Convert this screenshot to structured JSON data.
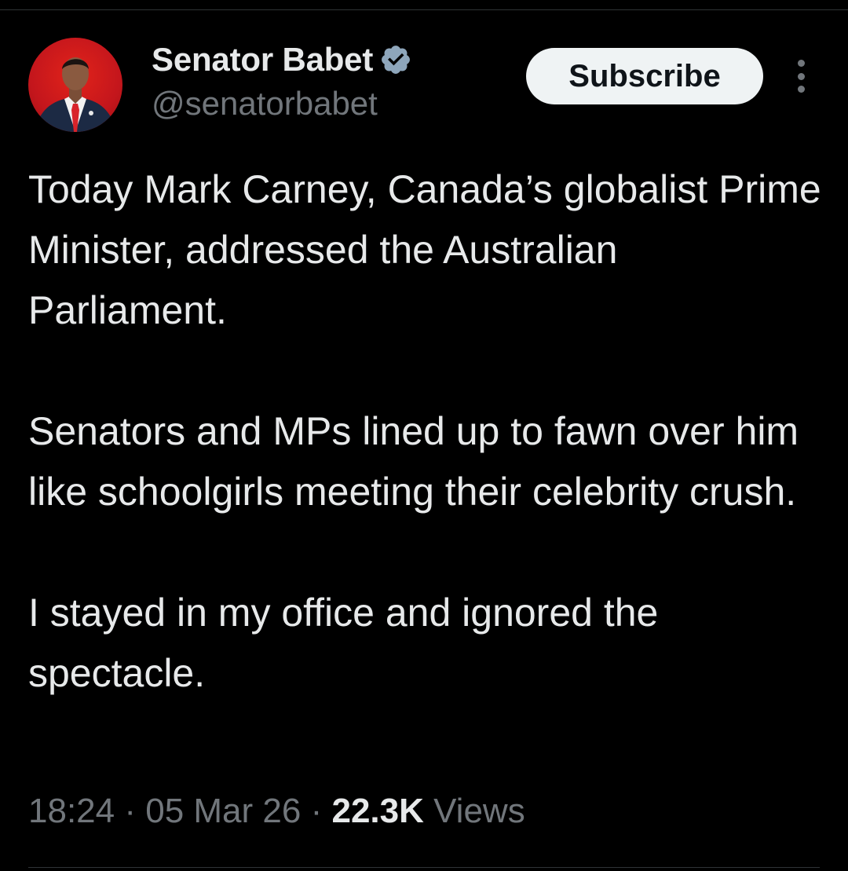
{
  "author": {
    "display_name": "Senator Babet",
    "handle": "@senatorbabet",
    "verified_icon": "verified-badge-icon",
    "avatar_icon": "profile-photo"
  },
  "header": {
    "subscribe_label": "Subscribe",
    "more_icon": "more-options-icon"
  },
  "tweet": {
    "paragraphs": [
      "Today Mark Carney, Canada’s globalist Prime Minister, addressed the Australian Parliament.",
      "Senators and MPs lined up to fawn over him like schoolgirls meeting their celebrity crush.",
      "I stayed in my office and ignored the spectacle."
    ]
  },
  "meta": {
    "time": "18:24",
    "separator": "·",
    "date": "05 Mar 26",
    "views_count": "22.3K",
    "views_label": "Views"
  },
  "colors": {
    "background": "#000000",
    "text_primary": "#e7e9ea",
    "text_secondary": "#71767b",
    "verified_blue": "#8ea6bb",
    "button_bg": "#eff3f4",
    "avatar_red": "#d71e1e"
  }
}
